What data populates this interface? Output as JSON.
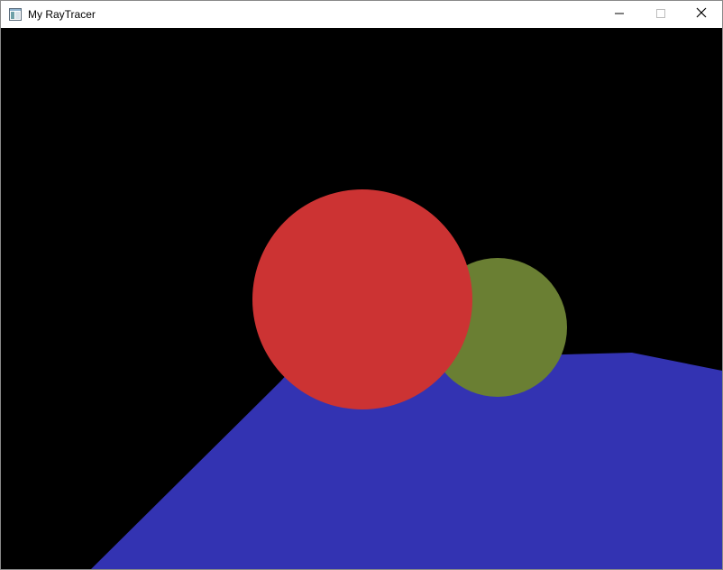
{
  "window": {
    "title": "My RayTracer",
    "app_icon": "window-app-icon",
    "controls": {
      "minimize": "minimize-icon",
      "maximize": "maximize-icon",
      "close": "close-icon"
    }
  },
  "scene": {
    "background_color": "#000000",
    "plane_color": "#3333b2",
    "red_sphere_color": "#cc3333",
    "green_sphere_color": "#6a7f33"
  }
}
